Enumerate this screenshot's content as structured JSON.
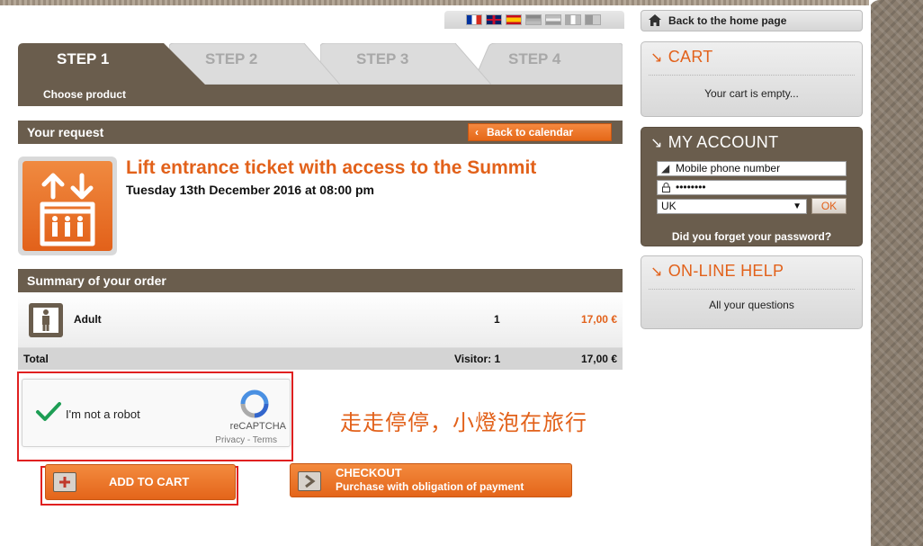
{
  "languages": [
    "French",
    "English",
    "Spanish",
    "German",
    "Dutch",
    "Italian",
    "Other"
  ],
  "steps": [
    {
      "label": "STEP 1",
      "active": true,
      "sub": "Choose product"
    },
    {
      "label": "STEP 2",
      "active": false
    },
    {
      "label": "STEP 3",
      "active": false
    },
    {
      "label": "STEP 4",
      "active": false
    }
  ],
  "request": {
    "title": "Your request",
    "back_calendar": "Back to calendar"
  },
  "product": {
    "title": "Lift entrance ticket with access to the Summit",
    "date": "Tuesday 13th December 2016 at 08:00 pm"
  },
  "summary": {
    "title": "Summary of your order",
    "item_label": "Adult",
    "item_qty": "1",
    "item_price": "17,00 €",
    "total_label": "Total",
    "visitor_label": "Visitor: 1",
    "total_price": "17,00 €"
  },
  "captcha": {
    "label": "I'm not a robot",
    "brand": "reCAPTCHA",
    "links": "Privacy - Terms"
  },
  "watermark": "走走停停，小燈泡在旅行",
  "buttons": {
    "add_to_cart": "ADD TO CART",
    "checkout_title": "CHECKOUT",
    "checkout_sub": "Purchase with obligation of payment"
  },
  "sidebar": {
    "home": "Back to the home page",
    "cart": {
      "title": "CART",
      "text": "Your cart is empty..."
    },
    "account": {
      "title": "MY ACCOUNT",
      "phone_placeholder": "Mobile phone number",
      "password_value": "••••••••",
      "country": "UK",
      "ok": "OK",
      "forgot": "Did you forget your password?"
    },
    "help": {
      "title": "ON-LINE HELP",
      "text": "All your questions"
    }
  },
  "colors": {
    "accent": "#e2611a",
    "brown": "#6a5d4d",
    "highlight": "#e02020"
  }
}
